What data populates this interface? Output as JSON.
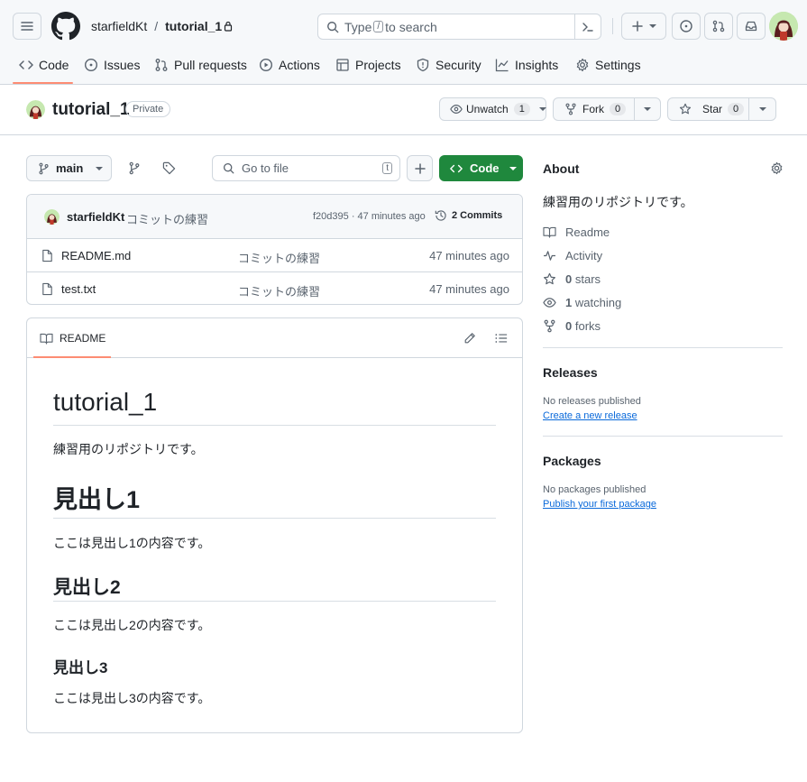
{
  "header": {
    "owner": "starfieldKt",
    "separator": "/",
    "repo": "tutorial_1",
    "search_prefix": "Type",
    "search_key": "/",
    "search_suffix": "to search"
  },
  "nav": {
    "tabs": [
      {
        "label": "Code"
      },
      {
        "label": "Issues"
      },
      {
        "label": "Pull requests"
      },
      {
        "label": "Actions"
      },
      {
        "label": "Projects"
      },
      {
        "label": "Security"
      },
      {
        "label": "Insights"
      },
      {
        "label": "Settings"
      }
    ]
  },
  "repo_bar": {
    "name": "tutorial_1",
    "visibility": "Private",
    "watch_label": "Unwatch",
    "watch_count": "1",
    "fork_label": "Fork",
    "fork_count": "0",
    "star_label": "Star",
    "star_count": "0"
  },
  "toolbar": {
    "branch": "main",
    "go_to_file": "Go to file",
    "go_to_file_key": "t",
    "code_button": "Code"
  },
  "commit": {
    "author": "starfieldKt",
    "message": "コミットの練習",
    "meta": "f20d395 · 47 minutes ago",
    "commits_label": "2 Commits"
  },
  "files": [
    {
      "name": "README.md",
      "message": "コミットの練習",
      "time": "47 minutes ago"
    },
    {
      "name": "test.txt",
      "message": "コミットの練習",
      "time": "47 minutes ago"
    }
  ],
  "readme": {
    "tab_label": "README",
    "title": "tutorial_1",
    "intro": "練習用のリポジトリです。",
    "h1": "見出し1",
    "p1": "ここは見出し1の内容です。",
    "h2": "見出し2",
    "p2": "ここは見出し2の内容です。",
    "h3": "見出し3",
    "p3": "ここは見出し3の内容です。"
  },
  "about": {
    "title": "About",
    "description": "練習用のリポジトリです。",
    "readme": "Readme",
    "activity": "Activity",
    "stars_count": "0",
    "stars_label": "stars",
    "watching_count": "1",
    "watching_label": "watching",
    "forks_count": "0",
    "forks_label": "forks"
  },
  "releases": {
    "title": "Releases",
    "empty": "No releases published",
    "link": "Create a new release"
  },
  "packages": {
    "title": "Packages",
    "empty": "No packages published",
    "link": "Publish your first package"
  },
  "colors": {
    "accent_green": "#1f883d",
    "tab_underline": "#fd8c73",
    "link": "#0969da",
    "border": "#d0d7de"
  }
}
